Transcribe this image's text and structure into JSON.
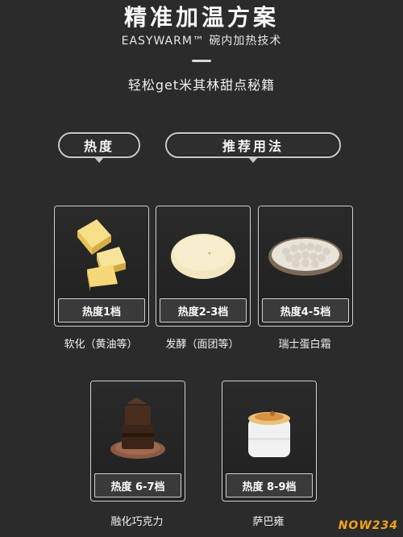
{
  "header": {
    "title": "精准加温方案",
    "subtitle": "EASYWARM™ 碗内加热技术",
    "tagline": "轻松get米其林甜点秘籍"
  },
  "tabs": {
    "heat_label": "热度",
    "method_label": "推荐用法"
  },
  "cards": [
    {
      "level": "热度1档",
      "caption": "软化（黄油等）",
      "image": "butter-cubes"
    },
    {
      "level": "热度2-3档",
      "caption": "发酵（面团等）",
      "image": "dough-ball"
    },
    {
      "level": "热度4-5档",
      "caption": "瑞士蛋白霜",
      "image": "meringue-plate"
    },
    {
      "level": "热度 6-7档",
      "caption": "融化巧克力",
      "image": "chocolate-stack"
    },
    {
      "level": "热度 8-9档",
      "caption": "萨巴雍",
      "image": "sabayon-cup"
    }
  ],
  "watermark": "NOW234"
}
